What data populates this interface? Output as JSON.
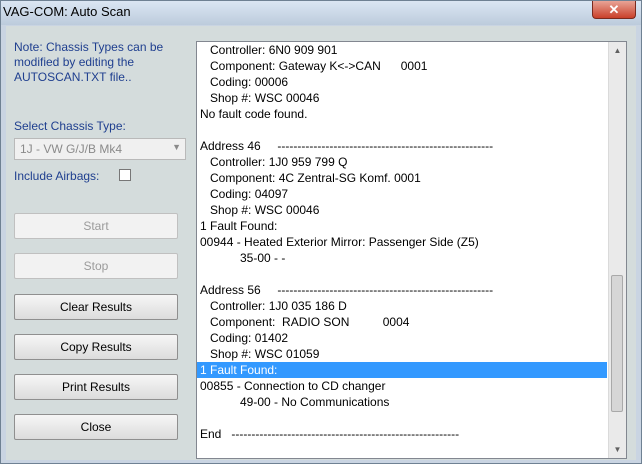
{
  "window": {
    "title": "VAG-COM: Auto Scan",
    "close_glyph": "✕"
  },
  "sidebar": {
    "note": "Note:  Chassis Types can be modified by editing the AUTOSCAN.TXT file..",
    "chassis_label": "Select Chassis Type:",
    "chassis_value": "1J - VW G/J/B Mk4",
    "airbags_label": "Include Airbags:",
    "airbags_checked": false
  },
  "buttons": {
    "start": "Start",
    "stop": "Stop",
    "clear": "Clear Results",
    "copy": "Copy Results",
    "print": "Print Results",
    "close": "Close"
  },
  "results": {
    "lines": [
      "   Controller: 6N0 909 901",
      "   Component: Gateway K<->CAN      0001",
      "   Coding: 00006",
      "   Shop #: WSC 00046",
      "No fault code found.",
      "",
      "Address 46     ------------------------------------------------------",
      "   Controller: 1J0 959 799 Q",
      "   Component: 4C Zentral-SG Komf. 0001",
      "   Coding: 04097",
      "   Shop #: WSC 00046",
      "1 Fault Found:",
      "00944 - Heated Exterior Mirror: Passenger Side (Z5)",
      "            35-00 - -",
      "",
      "Address 56     ------------------------------------------------------",
      "   Controller: 1J0 035 186 D",
      "   Component:  RADIO SON          0004",
      "   Coding: 01402",
      "   Shop #: WSC 01059",
      "1 Fault Found:",
      "00855 - Connection to CD changer",
      "            49-00 - No Communications",
      "",
      "End   ---------------------------------------------------------"
    ],
    "selected_index": 20
  }
}
